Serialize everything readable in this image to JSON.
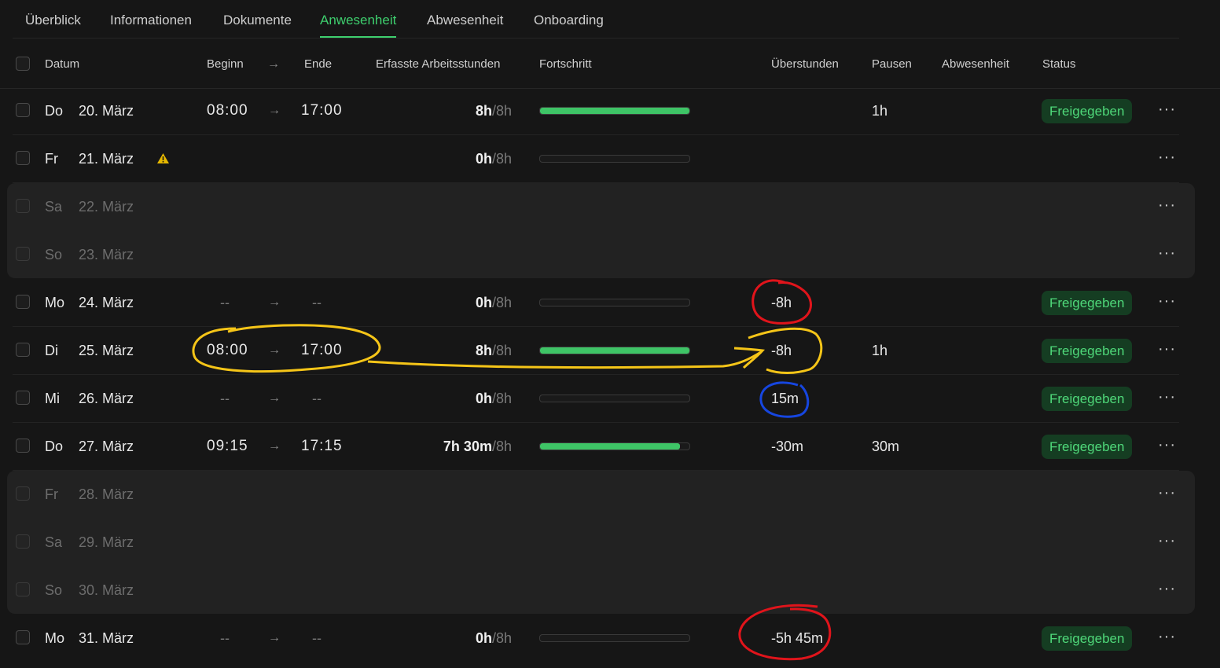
{
  "tabs": [
    {
      "label": "Überblick"
    },
    {
      "label": "Informationen"
    },
    {
      "label": "Dokumente"
    },
    {
      "label": "Anwesenheit"
    },
    {
      "label": "Abwesenheit"
    },
    {
      "label": "Onboarding"
    }
  ],
  "active_tab": "Anwesenheit",
  "columns": {
    "datum": "Datum",
    "beginn": "Beginn",
    "ende": "Ende",
    "hours": "Erfasste Arbeitsstunden",
    "progress": "Fortschritt",
    "overtime": "Überstunden",
    "breaks": "Pausen",
    "absence": "Abwesenheit",
    "status": "Status"
  },
  "colors": {
    "accent": "#3ecf6e",
    "badge_bg": "#153d22",
    "annot_red": "#e0141b",
    "annot_yellow": "#f5c518",
    "annot_blue": "#1646e0",
    "warning": "#e6b800"
  },
  "icons": {
    "arrow": "→",
    "more": "···",
    "warning": "warning-triangle-icon"
  },
  "rows": [
    {
      "day": "Do",
      "date": "20. März",
      "begin": "08:00",
      "end": "17:00",
      "hours": "8h",
      "total": "/8h",
      "progress": 1.0,
      "overtime": "",
      "breaks": "1h",
      "status": "Freigegeben"
    },
    {
      "day": "Fr",
      "date": "21. März",
      "warning": true,
      "begin": "",
      "end": "",
      "hours": "0h",
      "total": "/8h",
      "progress": 0.0,
      "overtime": "",
      "breaks": "",
      "status": ""
    },
    {
      "day": "Sa",
      "date": "22. März",
      "weekend": true
    },
    {
      "day": "So",
      "date": "23. März",
      "weekend": true
    },
    {
      "day": "Mo",
      "date": "24. März",
      "begin": "--",
      "end": "--",
      "hours": "0h",
      "total": "/8h",
      "progress": 0.0,
      "overtime": "-8h",
      "breaks": "",
      "status": "Freigegeben"
    },
    {
      "day": "Di",
      "date": "25. März",
      "begin": "08:00",
      "end": "17:00",
      "hours": "8h",
      "total": "/8h",
      "progress": 1.0,
      "overtime": "-8h",
      "breaks": "1h",
      "status": "Freigegeben"
    },
    {
      "day": "Mi",
      "date": "26. März",
      "begin": "--",
      "end": "--",
      "hours": "0h",
      "total": "/8h",
      "progress": 0.0,
      "overtime": "15m",
      "breaks": "",
      "status": "Freigegeben"
    },
    {
      "day": "Do",
      "date": "27. März",
      "begin": "09:15",
      "end": "17:15",
      "hours": "7h 30m",
      "total": "/8h",
      "progress": 0.9375,
      "overtime": "-30m",
      "breaks": "30m",
      "status": "Freigegeben"
    },
    {
      "day": "Fr",
      "date": "28. März",
      "weekend": true
    },
    {
      "day": "Sa",
      "date": "29. März",
      "weekend": true
    },
    {
      "day": "So",
      "date": "30. März",
      "weekend": true
    },
    {
      "day": "Mo",
      "date": "31. März",
      "begin": "--",
      "end": "--",
      "hours": "0h",
      "total": "/8h",
      "progress": 0.0,
      "overtime": "-5h 45m",
      "breaks": "",
      "status": "Freigegeben"
    }
  ]
}
